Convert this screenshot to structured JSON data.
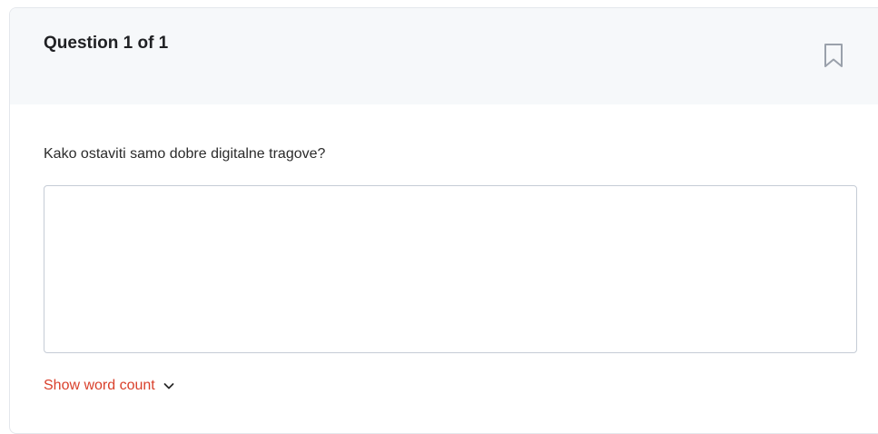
{
  "question": {
    "header_title": "Question 1 of 1",
    "text": "Kako ostaviti samo dobre digitalne tragove?",
    "answer_value": "",
    "answer_placeholder": ""
  },
  "word_count": {
    "label": "Show word count"
  },
  "icons": {
    "bookmark": "bookmark-icon",
    "chevron": "chevron-down-icon"
  },
  "colors": {
    "header_bg": "#f6f8fa",
    "accent_link": "#d9402b",
    "border": "#c5ccd6",
    "icon_gray": "#9aa1ab"
  }
}
